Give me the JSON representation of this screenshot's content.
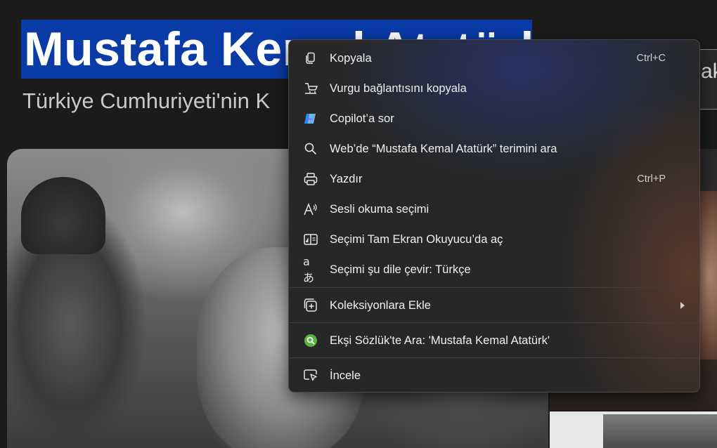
{
  "page": {
    "title": "Mustafa Kemal Atatürk",
    "subtitle": "Türkiye Cumhuriyeti'nin K",
    "side_tab": "ak"
  },
  "context_menu": {
    "items": [
      {
        "id": "copy",
        "label": "Kopyala",
        "icon": "copy-icon",
        "shortcut": "Ctrl+C"
      },
      {
        "id": "copy-highlight-link",
        "label": "Vurgu bağlantısını kopyala",
        "icon": "highlight-link-icon",
        "shortcut": ""
      },
      {
        "id": "ask-copilot",
        "label": "Copilot’a sor",
        "icon": "copilot-icon",
        "shortcut": ""
      },
      {
        "id": "web-search",
        "label": "Web’de “Mustafa Kemal Atatürk” terimini ara",
        "icon": "search-icon",
        "shortcut": ""
      },
      {
        "id": "print",
        "label": "Yazdır",
        "icon": "printer-icon",
        "shortcut": "Ctrl+P"
      },
      {
        "id": "read-aloud",
        "label": "Sesli okuma seçimi",
        "icon": "read-aloud-icon",
        "shortcut": ""
      },
      {
        "id": "immersive-reader",
        "label": "Seçimi Tam Ekran Okuyucu’da aç",
        "icon": "immersive-reader-icon",
        "shortcut": ""
      },
      {
        "id": "translate",
        "label": "Seçimi şu dile çevir: Türkçe",
        "icon": "translate-icon",
        "shortcut": "",
        "icon_text": "aあ"
      },
      {
        "id": "add-to-collections",
        "label": "Koleksiyonlara Ekle",
        "icon": "collections-icon",
        "shortcut": "",
        "submenu": true
      },
      {
        "id": "eksi-search",
        "label": "Ekşi Sözlük'te Ara: 'Mustafa Kemal Atatürk'",
        "icon": "eksi-sozluk-icon",
        "shortcut": ""
      },
      {
        "id": "inspect",
        "label": "İncele",
        "icon": "inspect-icon",
        "shortcut": ""
      }
    ]
  },
  "colors": {
    "selection_highlight": "#0a3aa6",
    "menu_background": "#272727",
    "copilot_blue": "#3ea0ff",
    "eksi_green": "#58b33f"
  }
}
